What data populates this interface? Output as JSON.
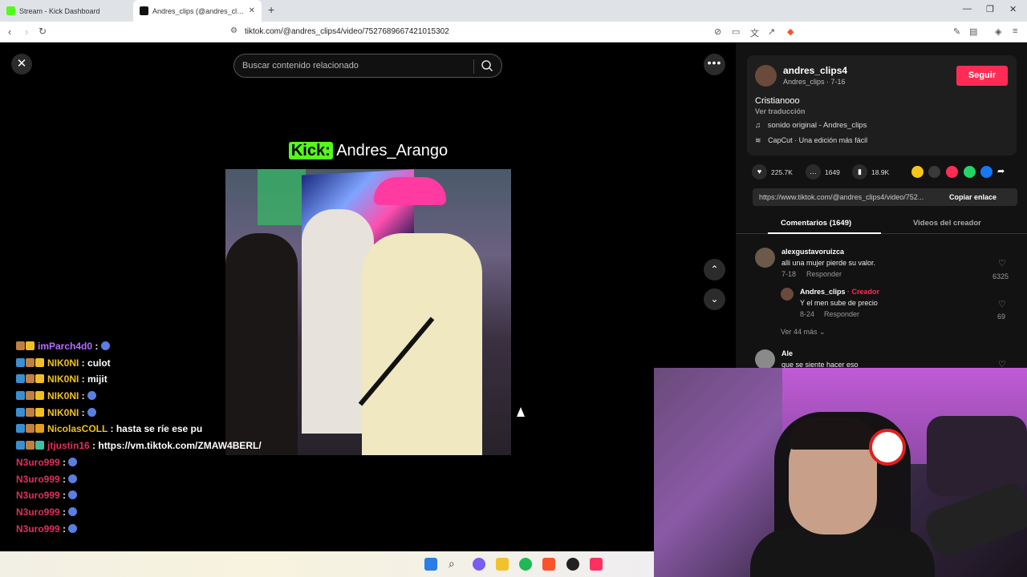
{
  "browser": {
    "tabs": [
      {
        "title": "Stream - Kick Dashboard",
        "favicon_color": "#53fc18"
      },
      {
        "title": "Andres_clips (@andres_clips4) | TikTok",
        "favicon_color": "#111111"
      }
    ],
    "url": "tiktok.com/@andres_clips4/video/7527689667421015302"
  },
  "player": {
    "search_placeholder": "Buscar contenido relacionado",
    "overlay_brand": "Kick:",
    "overlay_channel": "Andres_Arango"
  },
  "chat": [
    {
      "user": "imParch4d0",
      "color": "#b56cff",
      "message": "",
      "badges": [
        "#c08040",
        "#f0c020"
      ]
    },
    {
      "user": "NIK0NI",
      "color": "#f0c020",
      "message": "culot",
      "badges": [
        "#3a8fd0",
        "#c08040",
        "#f0c020"
      ]
    },
    {
      "user": "NIK0NI",
      "color": "#f0c020",
      "message": "mijit",
      "badges": [
        "#3a8fd0",
        "#c08040",
        "#f0c020"
      ]
    },
    {
      "user": "NIK0NI",
      "color": "#f0c020",
      "message": "",
      "badges": [
        "#3a8fd0",
        "#c08040",
        "#f0c020"
      ]
    },
    {
      "user": "NIK0NI",
      "color": "#f0c020",
      "message": "",
      "badges": [
        "#3a8fd0",
        "#c08040",
        "#f0c020"
      ]
    },
    {
      "user": "NicolasCOLL",
      "color": "#f0c020",
      "message": "hasta se ríe ese pu",
      "badges": [
        "#3a8fd0",
        "#c08040",
        "#e0a020"
      ]
    },
    {
      "user": "jtjustin16",
      "color": "#e0305a",
      "message": "https://vm.tiktok.com/ZMAW4BERL/",
      "badges": [
        "#3a8fd0",
        "#c08040",
        "#40c0a0"
      ]
    },
    {
      "user": "N3uro999",
      "color": "#e0305a",
      "message": "",
      "badges": []
    },
    {
      "user": "N3uro999",
      "color": "#e0305a",
      "message": "",
      "badges": []
    },
    {
      "user": "N3uro999",
      "color": "#e0305a",
      "message": "",
      "badges": []
    },
    {
      "user": "N3uro999",
      "color": "#e0305a",
      "message": "",
      "badges": []
    },
    {
      "user": "N3uro999",
      "color": "#e0305a",
      "message": "",
      "badges": []
    }
  ],
  "chat_separator": " : ",
  "creator": {
    "username": "andres_clips4",
    "subline": "Andres_clips · 7-16",
    "follow_label": "Seguir",
    "description": "Cristianooo",
    "translate_label": "Ver traducción",
    "sound": "sonido original - Andres_clips",
    "capcut": "CapCut · Una edición más fácil"
  },
  "stats": {
    "likes": "225.7K",
    "comments": "1649",
    "saves": "18.9K"
  },
  "link": {
    "url": "https://www.tiktok.com/@andres_clips4/video/752...",
    "copy_label": "Copiar enlace"
  },
  "panel_tabs": {
    "comments": "Comentarios (1649)",
    "creator_videos": "Videos del creador"
  },
  "comments": [
    {
      "user": "alexgustavoruizca",
      "text": "alli una mujer pierde su valor.",
      "date": "7-18",
      "reply": "Responder",
      "likes": "6325"
    },
    {
      "user": "Andres_clips",
      "creator_tag": " · Creador",
      "text": "Y el men sube de precio",
      "date": "8-24",
      "reply": "Responder",
      "likes": "69"
    },
    {
      "user": "Ale",
      "text": "que se siente hacer eso"
    }
  ],
  "more_replies": "Ver 44 más",
  "colors": {
    "accent": "#fe2c55",
    "kick_green": "#53fc18"
  }
}
